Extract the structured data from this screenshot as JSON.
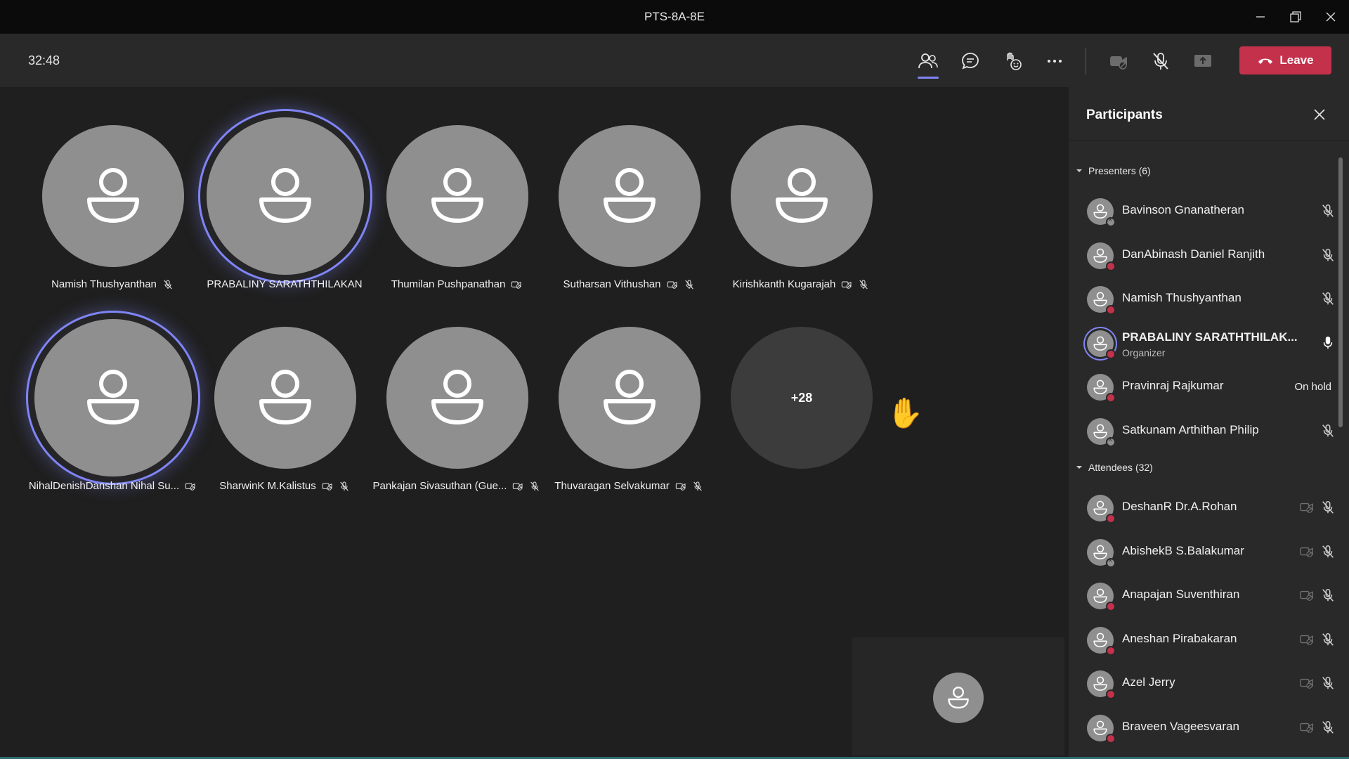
{
  "window": {
    "title": "PTS-8A-8E"
  },
  "toolbar": {
    "timer": "32:48",
    "leave_label": "Leave",
    "icons": [
      "people-icon",
      "chat-icon",
      "reactions-icon",
      "more-icon",
      "camera-off-icon",
      "mic-off-icon",
      "share-icon"
    ]
  },
  "stage": {
    "tiles": [
      {
        "name": "Namish Thushyanthan",
        "speaking": false,
        "camera_off": false,
        "muted": true
      },
      {
        "name": "PRABALINY SARATHTHILAKAN",
        "speaking": true,
        "camera_off": false,
        "muted": false
      },
      {
        "name": "Thumilan Pushpanathan",
        "speaking": false,
        "camera_off": true,
        "muted": false
      },
      {
        "name": "Sutharsan Vithushan",
        "speaking": false,
        "camera_off": true,
        "muted": true
      },
      {
        "name": "Kirishkanth Kugarajah",
        "speaking": false,
        "camera_off": true,
        "muted": true
      },
      {
        "name": "NihalDenishDanshan Nihal Su...",
        "speaking": true,
        "camera_off": true,
        "muted": false
      },
      {
        "name": "SharwinK M.Kalistus",
        "speaking": false,
        "camera_off": true,
        "muted": true
      },
      {
        "name": "Pankajan Sivasuthan (Gue...",
        "speaking": false,
        "camera_off": true,
        "muted": true
      },
      {
        "name": "Thuvaragan Selvakumar",
        "speaking": false,
        "camera_off": true,
        "muted": true
      }
    ],
    "overflow_count": "+28",
    "raise_hand": "✋"
  },
  "panel": {
    "title": "Participants",
    "presenters_header": "Presenters (6)",
    "attendees_header": "Attendees (32)",
    "presenters": [
      {
        "name": "Bavinson Gnanatheran",
        "status": "offline",
        "right": "mic-off"
      },
      {
        "name": "DanAbinash Daniel Ranjith",
        "status": "busy",
        "right": "mic-off"
      },
      {
        "name": "Namish Thushyanthan",
        "status": "busy",
        "right": "mic-off"
      },
      {
        "name": "PRABALINY SARATHTHILAK...",
        "role": "Organizer",
        "status": "busy",
        "right": "mic-on",
        "speaking": true
      },
      {
        "name": "Pravinraj Rajkumar",
        "status": "busy",
        "right": "on-hold",
        "right_text": "On hold"
      },
      {
        "name": "Satkunam Arthithan Philip",
        "status": "offline",
        "right": "mic-off"
      }
    ],
    "attendees": [
      {
        "name": "DeshanR Dr.A.Rohan",
        "status": "busy"
      },
      {
        "name": "AbishekB S.Balakumar",
        "status": "offline"
      },
      {
        "name": "Anapajan Suventhiran",
        "status": "busy"
      },
      {
        "name": "Aneshan Pirabakaran",
        "status": "busy"
      },
      {
        "name": "Azel Jerry",
        "status": "busy"
      },
      {
        "name": "Braveen Vageesvaran",
        "status": "busy"
      }
    ]
  },
  "colors": {
    "accent": "#7f85f5",
    "leave": "#c4314b",
    "avatar": "#8f8f8f",
    "stage_bg": "#1f1f1f",
    "panel_bg": "#292929"
  }
}
